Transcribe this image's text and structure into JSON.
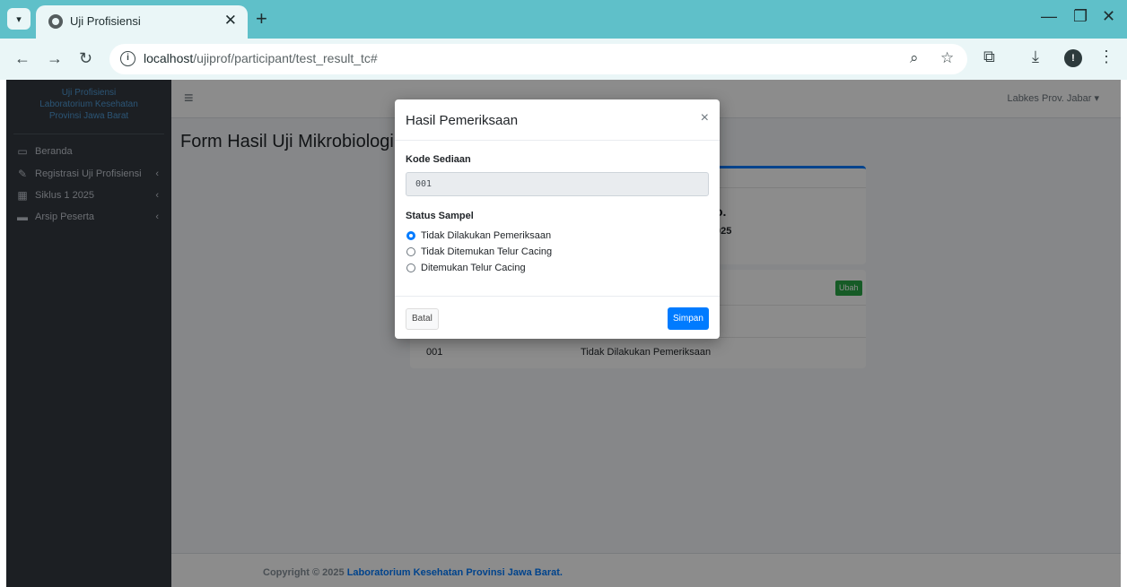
{
  "browser": {
    "tab_title": "Uji Profisiensi",
    "url_host": "localhost",
    "url_path": "/ujiprof/participant/test_result_tc#"
  },
  "sidebar": {
    "brand_lines": [
      "Uji Profisiensi",
      "Laboratorium Kesehatan",
      "Provinsi Jawa Barat"
    ],
    "items": [
      {
        "label": "Beranda",
        "icon": "monitor-icon"
      },
      {
        "label": "Registrasi Uji Profisiensi",
        "icon": "edit-icon"
      },
      {
        "label": "Siklus 1 2025",
        "icon": "calendar-icon"
      },
      {
        "label": "Arsip Peserta",
        "icon": "folder-icon"
      }
    ]
  },
  "topnav": {
    "user": "Labkes Prov. Jabar"
  },
  "content": {
    "title": "Form Hasil Uji Mikrobiologi -",
    "card1_big": "o.",
    "card1_small": "025",
    "ubah_label": "Ubah",
    "row": {
      "kode": "001",
      "status": "Tidak Dilakukan Pemeriksaan"
    }
  },
  "footer": {
    "prefix": "Copyright © 2025 ",
    "link": "Laboratorium Kesehatan Provinsi Jawa Barat."
  },
  "modal": {
    "title": "Hasil Pemeriksaan",
    "close": "×",
    "kode_label": "Kode Sediaan",
    "kode_value": "001",
    "status_label": "Status Sampel",
    "options": [
      {
        "label": "Tidak Dilakukan Pemeriksaan",
        "checked": true
      },
      {
        "label": "Tidak Ditemukan Telur Cacing",
        "checked": false
      },
      {
        "label": "Ditemukan Telur Cacing",
        "checked": false
      }
    ],
    "cancel_label": "Batal",
    "save_label": "Simpan"
  },
  "colors": {
    "tab_strip": "#5fc0c9",
    "primary": "#007bff",
    "success": "#28a745",
    "sidebar": "#343a40"
  }
}
